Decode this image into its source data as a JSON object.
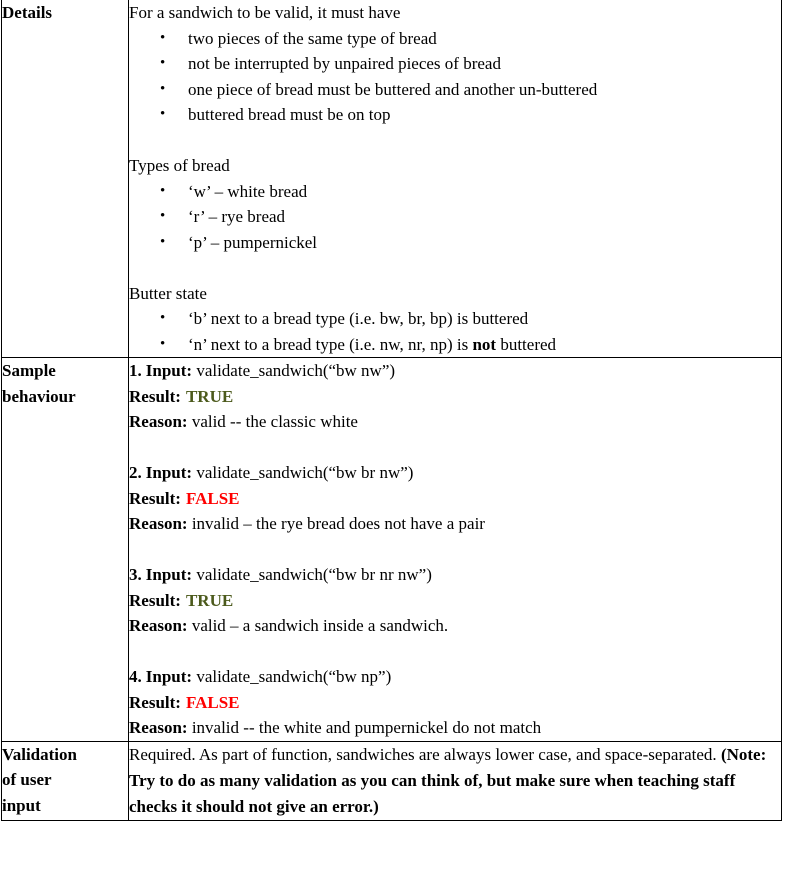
{
  "document": {
    "type": "specification-table",
    "colors": {
      "true_result": "#4c5a1c",
      "false_result": "#ff0000",
      "text": "#000000",
      "border": "#000000",
      "background": "#ffffff"
    },
    "rows": [
      {
        "label": "Details",
        "label_lines": [
          "Details"
        ],
        "content": {
          "intro": "For a sandwich to be valid, it must have",
          "rules": [
            "two pieces of the same type of bread",
            "not be interrupted by unpaired pieces of bread",
            "one piece of bread must be buttered and another un-buttered",
            "buttered bread must be on top"
          ],
          "bread_heading": "Types of bread",
          "bread_types": [
            "‘w’ – white bread",
            "‘r’ – rye bread",
            "‘p’ – pumpernickel"
          ],
          "butter_heading": "Butter state",
          "butter_states": [
            {
              "prefix": "‘b’ next to a bread type (i.e. bw, br, bp) is buttered",
              "emphasis": "",
              "suffix": ""
            },
            {
              "prefix": "‘n’ next to a bread type (i.e. nw, nr, np) is ",
              "emphasis": "not",
              "suffix": " buttered"
            }
          ]
        }
      },
      {
        "label": "Sample behaviour",
        "label_lines": [
          "Sample",
          "behaviour"
        ],
        "content": {
          "input_label": "Input:",
          "result_label": "Result:",
          "reason_label": "Reason:",
          "examples": [
            {
              "number": "1.",
              "input": " validate_sandwich(“bw nw”)",
              "result": "TRUE",
              "result_state": "true",
              "reason": " valid -- the classic white"
            },
            {
              "number": "2.",
              "input": " validate_sandwich(“bw br nw”)",
              "result": "FALSE",
              "result_state": "false",
              "reason": " invalid – the rye bread does not have a pair"
            },
            {
              "number": "3.",
              "input": " validate_sandwich(“bw br nr nw”)",
              "result": "TRUE",
              "result_state": "true",
              "reason": " valid – a sandwich inside a sandwich."
            },
            {
              "number": "4.",
              "input": " validate_sandwich(“bw np”)",
              "result": "FALSE",
              "result_state": "false",
              "reason": " invalid -- the white and pumpernickel do not match"
            }
          ]
        }
      },
      {
        "label": "Validation of user input",
        "label_lines": [
          "Validation",
          "of user",
          "input"
        ],
        "content": {
          "normal_text": "Required. As part of function, sandwiches are always lower case, and space-separated.  ",
          "bold_note": "(Note: Try to do as many validation as you can think of, but make sure when teaching staff checks it should not give an error.)"
        }
      }
    ]
  }
}
